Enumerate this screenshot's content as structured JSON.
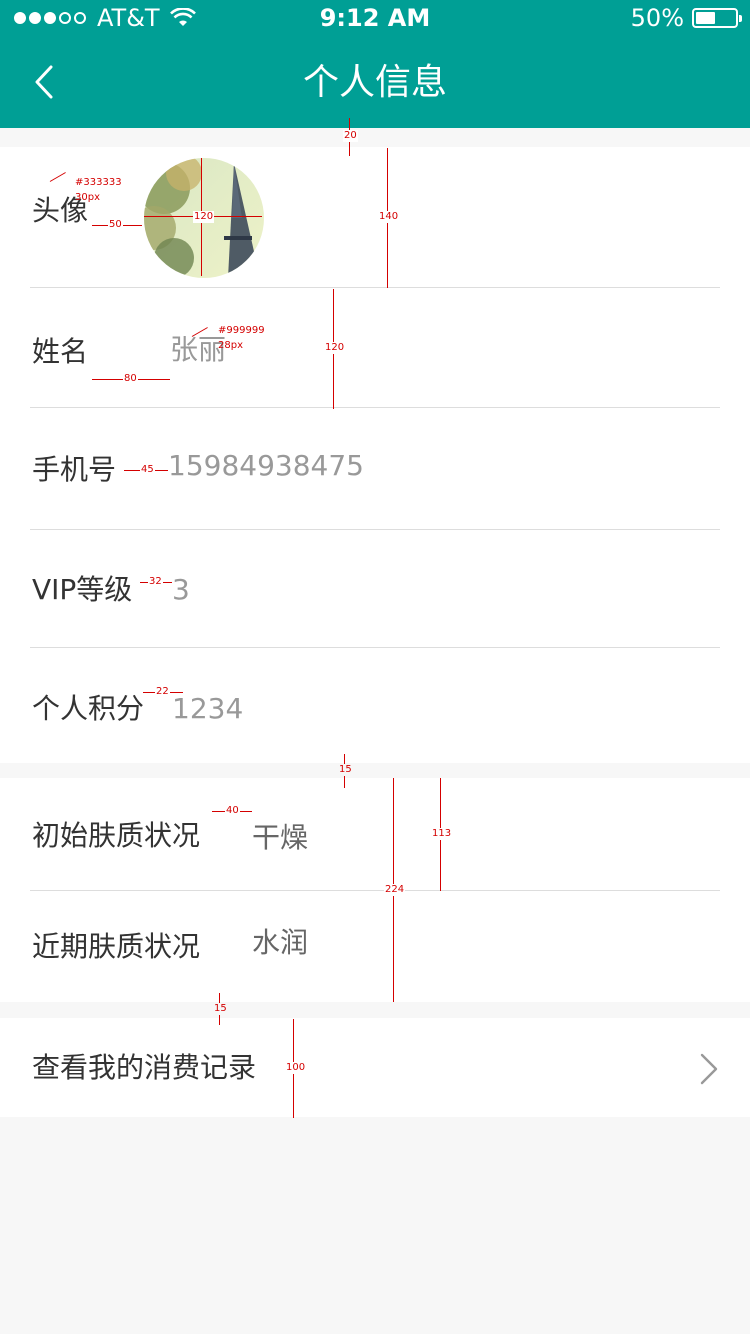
{
  "status_bar": {
    "carrier": "AT&T",
    "time": "9:12 AM",
    "battery": "50%",
    "battery_level": 0.5
  },
  "nav": {
    "title": "个人信息",
    "back_icon": "chevron-left-icon"
  },
  "profile": {
    "avatar_label": "头像",
    "name_label": "姓名",
    "name_value": "张丽",
    "phone_label": "手机号",
    "phone_value": "15984938475",
    "vip_label": "VIP等级",
    "vip_value": "3",
    "points_label": "个人积分",
    "points_value": "1234"
  },
  "skin": {
    "initial_label": "初始肤质状况",
    "initial_value": "干燥",
    "recent_label": "近期肤质状况",
    "recent_value": "水润"
  },
  "records": {
    "label": "查看我的消费记录",
    "chevron_icon": "chevron-right-icon"
  },
  "annotations": {
    "gap_top": "20",
    "color_label": "#333333",
    "size_label": "30px",
    "avatar_gap": "50",
    "avatar_size": "120",
    "row_avatar_h": "140",
    "color_value": "#999999",
    "size_value": "28px",
    "name_gap": "80",
    "row_h": "120",
    "phone_gap": "45",
    "vip_gap": "32",
    "points_gap": "22",
    "section_gap": "15",
    "skin_gap": "40",
    "skin_row_h": "113",
    "skin_section_h": "224",
    "section_gap2": "15",
    "records_h": "100"
  },
  "colors": {
    "header": "#009f95",
    "label": "#333333",
    "value": "#999999",
    "annotation": "#d40000"
  }
}
